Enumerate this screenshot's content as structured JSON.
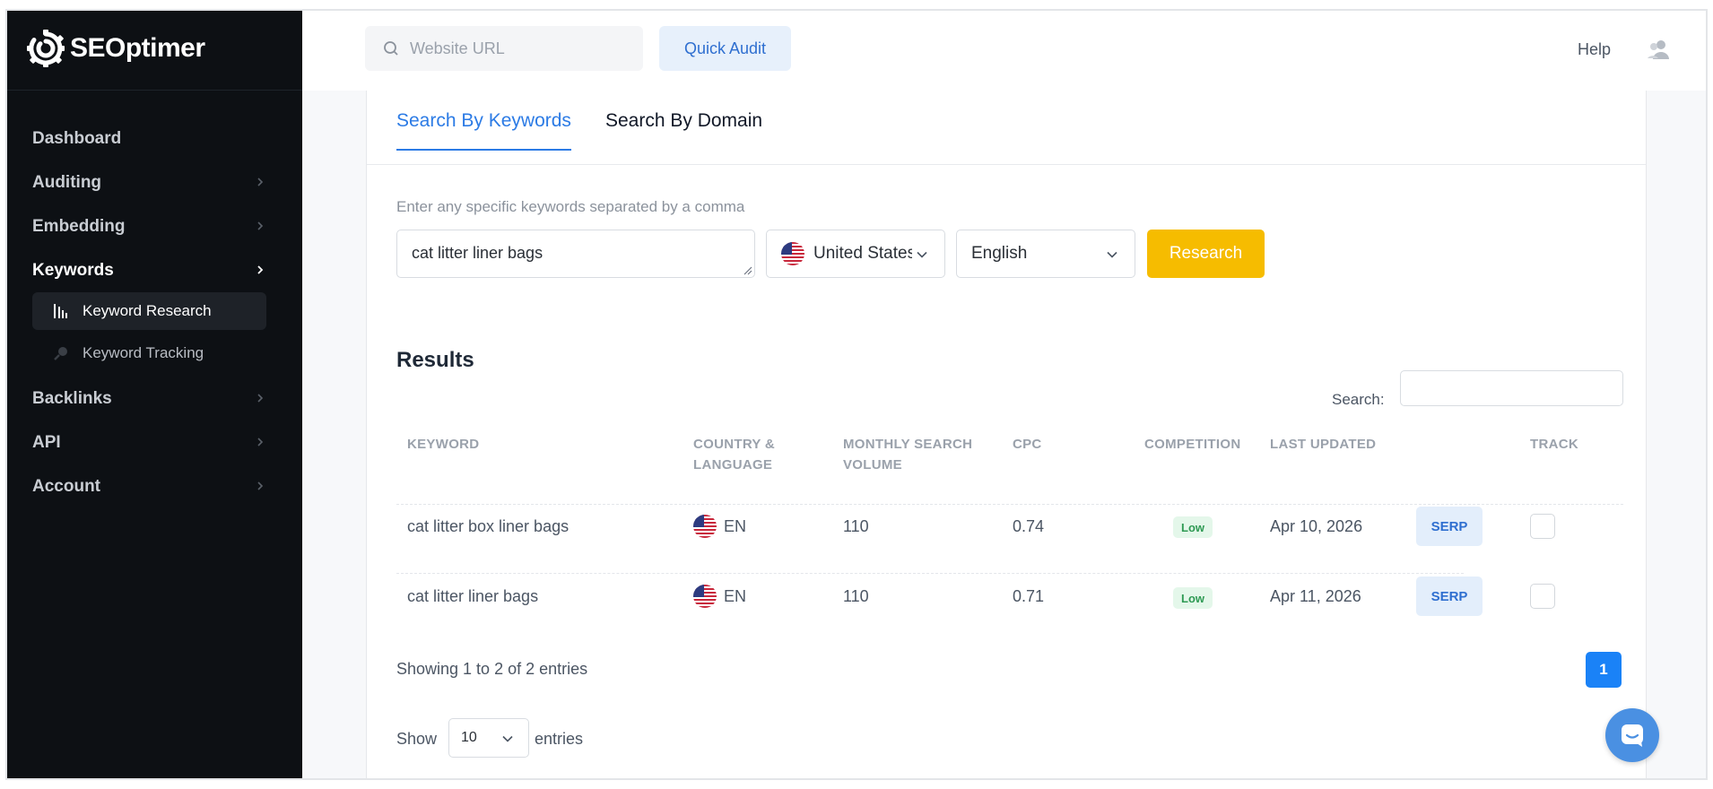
{
  "brand": {
    "name": "SEOptimer"
  },
  "sidebar": {
    "items": [
      {
        "label": "Dashboard"
      },
      {
        "label": "Auditing"
      },
      {
        "label": "Embedding"
      },
      {
        "label": "Keywords"
      },
      {
        "label": "Backlinks"
      },
      {
        "label": "API"
      },
      {
        "label": "Account"
      }
    ],
    "subitems": [
      {
        "label": "Keyword Research",
        "icon": "bar-chart-icon"
      },
      {
        "label": "Keyword Tracking",
        "icon": "key-icon"
      }
    ]
  },
  "topbar": {
    "url_placeholder": "Website URL",
    "quick_audit_label": "Quick Audit",
    "help_label": "Help"
  },
  "tabs": [
    {
      "label": "Search By Keywords"
    },
    {
      "label": "Search By Domain"
    }
  ],
  "form": {
    "hint": "Enter any specific keywords separated by a comma",
    "keywords_value": "cat litter liner bags",
    "country": "United States",
    "language": "English",
    "research_label": "Research"
  },
  "results": {
    "title": "Results",
    "search_label": "Search:",
    "columns": [
      "KEYWORD",
      "COUNTRY & LANGUAGE",
      "MONTHLY SEARCH VOLUME",
      "CPC",
      "COMPETITION",
      "LAST UPDATED",
      "TRACK"
    ],
    "rows": [
      {
        "keyword": "cat litter box liner bags",
        "lang": "EN",
        "volume": "110",
        "cpc": "0.74",
        "competition": "Low",
        "updated": "Apr 10, 2026",
        "serp": "SERP"
      },
      {
        "keyword": "cat litter liner bags",
        "lang": "EN",
        "volume": "110",
        "cpc": "0.71",
        "competition": "Low",
        "updated": "Apr 11, 2026",
        "serp": "SERP"
      }
    ],
    "showing": "Showing 1 to 2 of 2 entries",
    "page": "1",
    "show_label": "Show",
    "entries_value": "10",
    "entries_label": "entries"
  },
  "colors": {
    "sidebar_bg": "#0d1014",
    "accent": "#2c7be5",
    "research_button": "#f6bc00",
    "low_badge_bg": "#e4f7ea",
    "low_badge_text": "#2f9a54"
  }
}
